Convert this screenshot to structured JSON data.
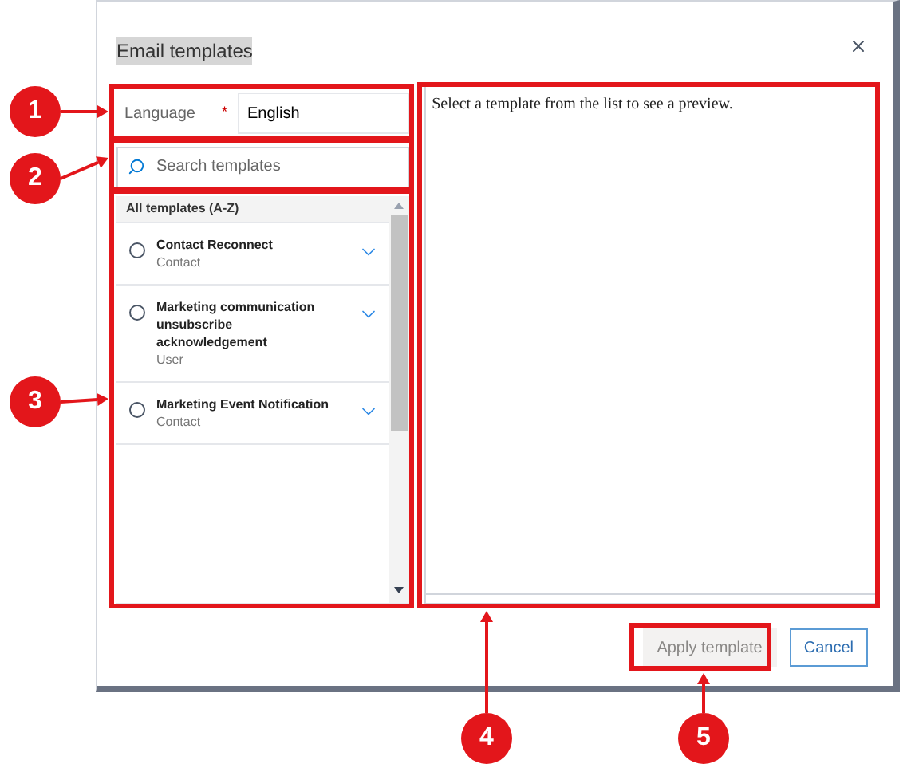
{
  "dialog": {
    "title": "Email templates"
  },
  "language": {
    "label": "Language",
    "required_mark": "*",
    "value": "English"
  },
  "search": {
    "placeholder": "Search templates"
  },
  "list": {
    "heading": "All templates (A-Z)",
    "items": [
      {
        "name": "Contact Reconnect",
        "entity": "Contact",
        "selected": false
      },
      {
        "name": "Marketing communication unsubscribe acknowledgement",
        "entity": "User",
        "selected": false
      },
      {
        "name": "Marketing Event Notification",
        "entity": "Contact",
        "selected": false
      }
    ]
  },
  "preview": {
    "text": "Select a template from the list to see a preview."
  },
  "buttons": [
    {
      "label": "Apply template",
      "kind": "primary",
      "disabled": true
    },
    {
      "label": "Cancel",
      "kind": "secondary",
      "disabled": false
    }
  ],
  "callouts": [
    {
      "number": "1"
    },
    {
      "number": "2"
    },
    {
      "number": "3"
    },
    {
      "number": "4"
    },
    {
      "number": "5"
    }
  ]
}
